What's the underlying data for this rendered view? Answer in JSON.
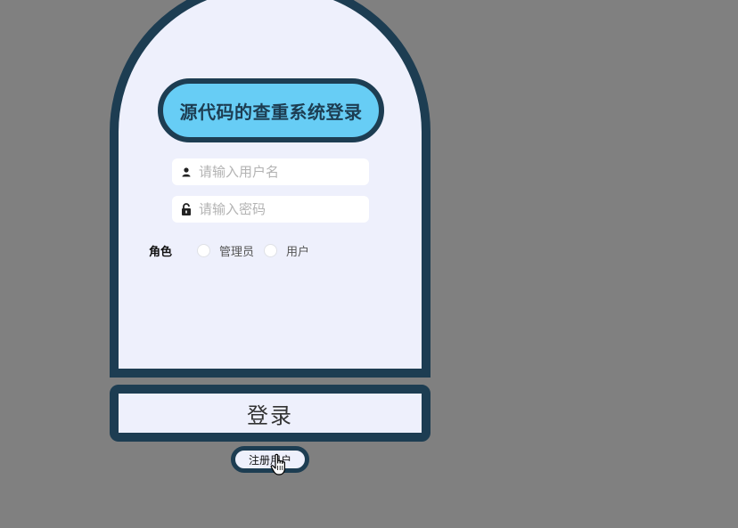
{
  "login": {
    "title": "源代码的查重系统登录",
    "username": {
      "placeholder": "请输入用户名",
      "value": "",
      "icon": "user-icon"
    },
    "password": {
      "placeholder": "请输入密码",
      "value": "",
      "icon": "lock-icon"
    },
    "role": {
      "label": "角色",
      "options": [
        "管理员",
        "用户"
      ],
      "selected": null
    },
    "submit_label": "登录",
    "register_label": "注册用户"
  },
  "colors": {
    "background": "#808080",
    "card": "#eef0fc",
    "border": "#1d3d52",
    "title_pill": "#67cdf5"
  }
}
